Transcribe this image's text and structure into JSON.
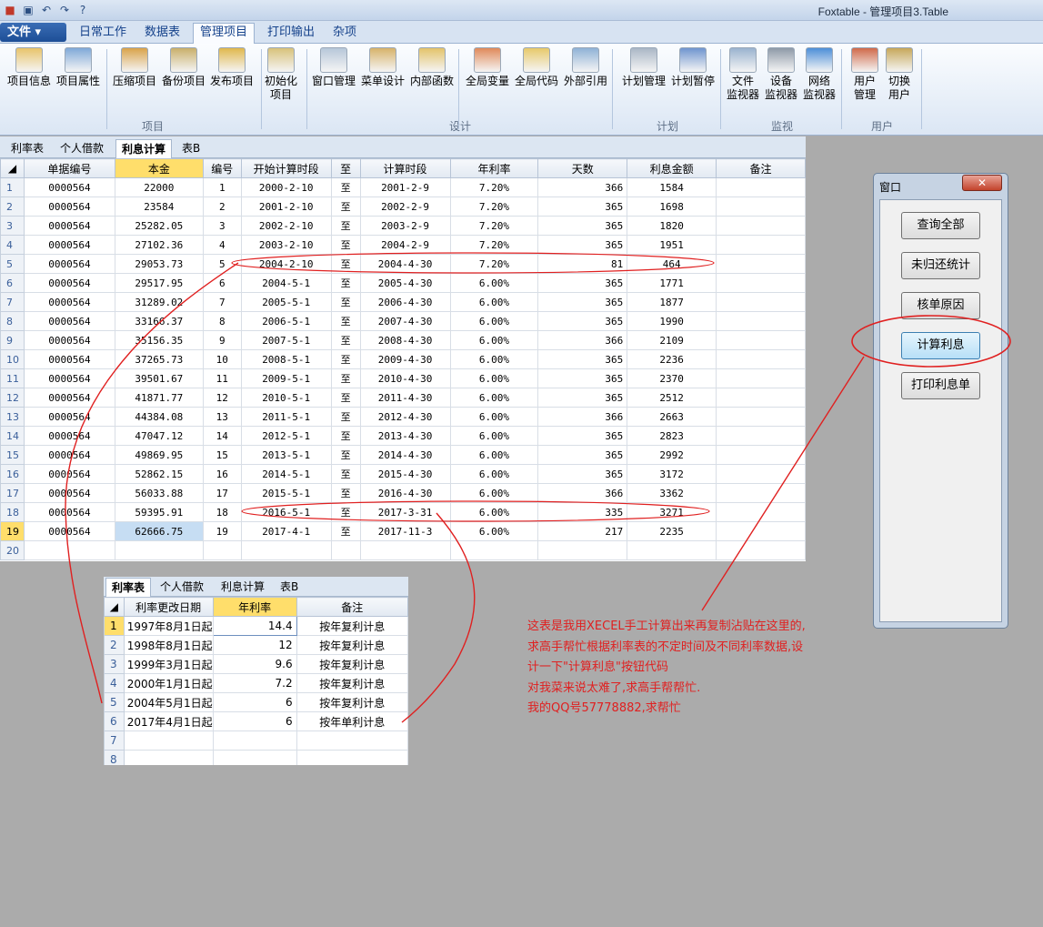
{
  "app": {
    "title": "Foxtable - 管理项目3.Table"
  },
  "menu": {
    "file": "文件",
    "tabs": [
      "日常工作",
      "数据表",
      "管理项目",
      "打印输出",
      "杂项"
    ]
  },
  "ribbon": {
    "groups": [
      "项目",
      "设计",
      "计划",
      "监视",
      "用户"
    ],
    "buttons": [
      {
        "label": "项目信息",
        "icon": "project-info-icon"
      },
      {
        "label": "项目属性",
        "icon": "project-properties-icon"
      },
      {
        "label": "压缩项目",
        "icon": "compress-project-icon"
      },
      {
        "label": "备份项目",
        "icon": "backup-project-icon"
      },
      {
        "label": "发布项目",
        "icon": "publish-project-icon"
      },
      {
        "label": "初始化\n项目",
        "icon": "init-project-icon"
      },
      {
        "label": "窗口管理",
        "icon": "window-manager-icon"
      },
      {
        "label": "菜单设计",
        "icon": "menu-design-icon"
      },
      {
        "label": "内部函数",
        "icon": "internal-function-icon"
      },
      {
        "label": "全局变量",
        "icon": "global-variable-icon"
      },
      {
        "label": "全局代码",
        "icon": "global-code-icon"
      },
      {
        "label": "外部引用",
        "icon": "external-reference-icon"
      },
      {
        "label": "计划管理",
        "icon": "schedule-manager-icon"
      },
      {
        "label": "计划暂停",
        "icon": "schedule-pause-icon"
      },
      {
        "label": "文件\n监视器",
        "icon": "file-monitor-icon"
      },
      {
        "label": "设备\n监视器",
        "icon": "device-monitor-icon"
      },
      {
        "label": "网络\n监视器",
        "icon": "network-monitor-icon"
      },
      {
        "label": "用户\n管理",
        "icon": "user-manager-icon"
      },
      {
        "label": "切换\n用户",
        "icon": "switch-user-icon"
      }
    ]
  },
  "sheet_tabs": [
    "利率表",
    "个人借款",
    "利息计算",
    "表B"
  ],
  "active_sheet": "利息计算",
  "main_table": {
    "columns": [
      "单据编号",
      "本金",
      "编号",
      "开始计算时段",
      "至",
      "计算时段",
      "年利率",
      "天数",
      "利息金额",
      "备注"
    ],
    "rows": [
      [
        "0000564",
        "22000",
        "1",
        "2000-2-10",
        "至",
        "2001-2-9",
        "7.20%",
        "366",
        "1584",
        ""
      ],
      [
        "0000564",
        "23584",
        "2",
        "2001-2-10",
        "至",
        "2002-2-9",
        "7.20%",
        "365",
        "1698",
        ""
      ],
      [
        "0000564",
        "25282.05",
        "3",
        "2002-2-10",
        "至",
        "2003-2-9",
        "7.20%",
        "365",
        "1820",
        ""
      ],
      [
        "0000564",
        "27102.36",
        "4",
        "2003-2-10",
        "至",
        "2004-2-9",
        "7.20%",
        "365",
        "1951",
        ""
      ],
      [
        "0000564",
        "29053.73",
        "5",
        "2004-2-10",
        "至",
        "2004-4-30",
        "7.20%",
        "81",
        "464",
        ""
      ],
      [
        "0000564",
        "29517.95",
        "6",
        "2004-5-1",
        "至",
        "2005-4-30",
        "6.00%",
        "365",
        "1771",
        ""
      ],
      [
        "0000564",
        "31289.02",
        "7",
        "2005-5-1",
        "至",
        "2006-4-30",
        "6.00%",
        "365",
        "1877",
        ""
      ],
      [
        "0000564",
        "33166.37",
        "8",
        "2006-5-1",
        "至",
        "2007-4-30",
        "6.00%",
        "365",
        "1990",
        ""
      ],
      [
        "0000564",
        "35156.35",
        "9",
        "2007-5-1",
        "至",
        "2008-4-30",
        "6.00%",
        "366",
        "2109",
        ""
      ],
      [
        "0000564",
        "37265.73",
        "10",
        "2008-5-1",
        "至",
        "2009-4-30",
        "6.00%",
        "365",
        "2236",
        ""
      ],
      [
        "0000564",
        "39501.67",
        "11",
        "2009-5-1",
        "至",
        "2010-4-30",
        "6.00%",
        "365",
        "2370",
        ""
      ],
      [
        "0000564",
        "41871.77",
        "12",
        "2010-5-1",
        "至",
        "2011-4-30",
        "6.00%",
        "365",
        "2512",
        ""
      ],
      [
        "0000564",
        "44384.08",
        "13",
        "2011-5-1",
        "至",
        "2012-4-30",
        "6.00%",
        "366",
        "2663",
        ""
      ],
      [
        "0000564",
        "47047.12",
        "14",
        "2012-5-1",
        "至",
        "2013-4-30",
        "6.00%",
        "365",
        "2823",
        ""
      ],
      [
        "0000564",
        "49869.95",
        "15",
        "2013-5-1",
        "至",
        "2014-4-30",
        "6.00%",
        "365",
        "2992",
        ""
      ],
      [
        "0000564",
        "52862.15",
        "16",
        "2014-5-1",
        "至",
        "2015-4-30",
        "6.00%",
        "365",
        "3172",
        ""
      ],
      [
        "0000564",
        "56033.88",
        "17",
        "2015-5-1",
        "至",
        "2016-4-30",
        "6.00%",
        "366",
        "3362",
        ""
      ],
      [
        "0000564",
        "59395.91",
        "18",
        "2016-5-1",
        "至",
        "2017-3-31",
        "6.00%",
        "335",
        "3271",
        ""
      ],
      [
        "0000564",
        "62666.75",
        "19",
        "2017-4-1",
        "至",
        "2017-11-3",
        "6.00%",
        "217",
        "2235",
        ""
      ],
      [
        "",
        "",
        "",
        "",
        "",
        "",
        "",
        "",
        "",
        ""
      ]
    ]
  },
  "window_panel": {
    "title": "窗口",
    "close": "✕",
    "buttons": [
      "查询全部",
      "未归还统计",
      "核单原因",
      "计算利息",
      "打印利息单"
    ]
  },
  "rate_table": {
    "tabs": [
      "利率表",
      "个人借款",
      "利息计算",
      "表B"
    ],
    "columns": [
      "利率更改日期",
      "年利率",
      "备注"
    ],
    "rows": [
      [
        "1997年8月1日起",
        "14.4",
        "按年复利计息"
      ],
      [
        "1998年8月1日起",
        "12",
        "按年复利计息"
      ],
      [
        "1999年3月1日起",
        "9.6",
        "按年复利计息"
      ],
      [
        "2000年1月1日起",
        "7.2",
        "按年复利计息"
      ],
      [
        "2004年5月1日起",
        "6",
        "按年复利计息"
      ],
      [
        "2017年4月1日起",
        "6",
        "按年单利计息"
      ],
      [
        "",
        "",
        ""
      ],
      [
        "",
        "",
        ""
      ]
    ]
  },
  "note": {
    "lines": [
      "这表是我用XECEL手工计算出来再复制沾贴在这里的,",
      "求高手帮忙根据利率表的不定时间及不同利率数据,设",
      "计一下\"计算利息\"按钮代码",
      "对我菜来说太难了,求高手帮帮忙.",
      "我的QQ号57778882,求帮忙"
    ]
  },
  "colors": {
    "annotation": "#e02020",
    "highlight": "#ffde6b",
    "selection": "#c6ddf3"
  }
}
